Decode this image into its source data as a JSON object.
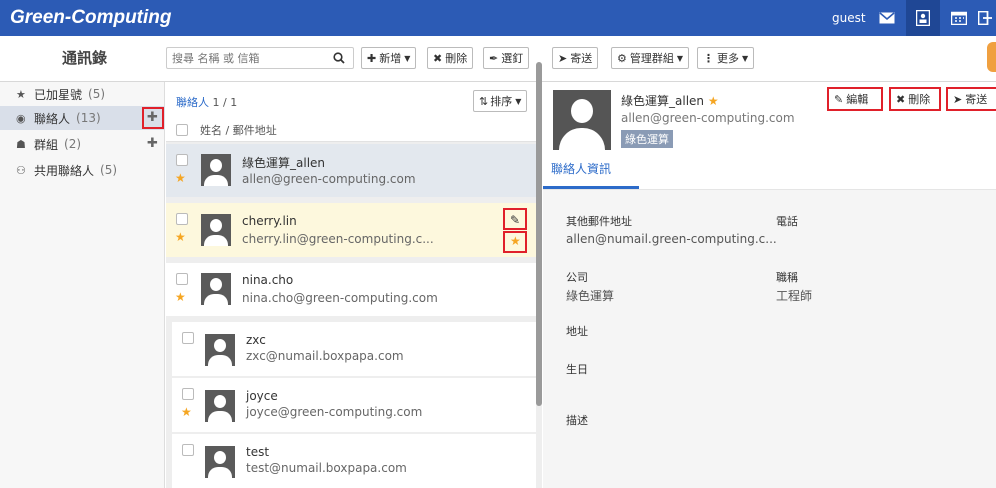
{
  "app": {
    "logo": "Green-Computing",
    "user": "guest",
    "title": "通訊錄"
  },
  "header_icons": [
    "mail-icon",
    "contacts-icon",
    "calendar-icon",
    "switch-icon"
  ],
  "toolbar": {
    "search_placeholder": "搜尋 名稱 或 信箱",
    "new_label": "新增",
    "delete_label": "刪除",
    "pin_label": "選釘",
    "send_label": "寄送",
    "manage_group_label": "管理群組",
    "more_label": "更多"
  },
  "sidebar": {
    "items": [
      {
        "icon": "star-icon",
        "label": "已加星號",
        "count": "(5)"
      },
      {
        "icon": "user-circle-icon",
        "label": "聯絡人",
        "count": "(13)"
      },
      {
        "icon": "group-icon",
        "label": "群組",
        "count": "(2)"
      },
      {
        "icon": "shared-icon",
        "label": "共用聯絡人",
        "count": "(5)"
      }
    ]
  },
  "list": {
    "count_label": "聯絡人",
    "count_value": "1 / 1",
    "sort_label": "排序",
    "column_header": "姓名 / 郵件地址",
    "contacts": [
      {
        "name": "綠色運算_allen",
        "email": "allen@green-computing.com",
        "starred": true
      },
      {
        "name": "cherry.lin",
        "email": "cherry.lin@green-computing.c...",
        "starred": true
      },
      {
        "name": "nina.cho",
        "email": "nina.cho@green-computing.com",
        "starred": true
      },
      {
        "name": "zxc",
        "email": "zxc@numail.boxpapa.com",
        "starred": false
      },
      {
        "name": "joyce",
        "email": "joyce@green-computing.com",
        "starred": true
      },
      {
        "name": "test",
        "email": "test@numail.boxpapa.com",
        "starred": false
      }
    ]
  },
  "detail": {
    "name": "綠色運算_allen",
    "email": "allen@green-computing.com",
    "tag": "綠色運算",
    "edit_label": "編輯",
    "delete_label": "刪除",
    "send_label": "寄送",
    "tab_label": "聯絡人資訊",
    "fields": {
      "other_email_label": "其他郵件地址",
      "other_email_value": "allen@numail.green-computing.c...",
      "phone_label": "電話",
      "company_label": "公司",
      "company_value": "綠色運算",
      "title_label": "職稱",
      "title_value": "工程師",
      "address_label": "地址",
      "birthday_label": "生日",
      "description_label": "描述"
    }
  },
  "colors": {
    "topbar": "#2c5bb5",
    "accent": "#2c6bc9",
    "star": "#f5a623",
    "highlight": "#e0202a",
    "selected_row": "#fdf8dd"
  }
}
